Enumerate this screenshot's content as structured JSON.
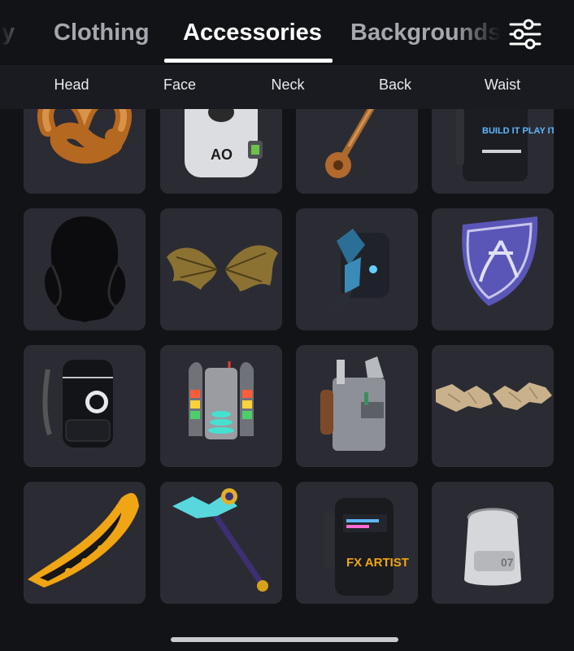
{
  "tabs": {
    "partial": "ly",
    "clothing": "Clothing",
    "accessories": "Accessories",
    "backgrounds": "Backgrounds",
    "active": "Accessories"
  },
  "subcategories": [
    "Head",
    "Face",
    "Neck",
    "Back",
    "Waist"
  ],
  "icons": {
    "filter": "sliders-icon"
  },
  "items": [
    {
      "name": "pretzel-accessory",
      "text": ""
    },
    {
      "name": "koala-backpack",
      "text": "AO"
    },
    {
      "name": "copper-mace",
      "text": ""
    },
    {
      "name": "build-it-backpack",
      "text": "BUILD IT PLAY IT"
    },
    {
      "name": "shadow-cloak",
      "text": ""
    },
    {
      "name": "golden-bat-wings",
      "text": ""
    },
    {
      "name": "blue-crystal-jetpack",
      "text": ""
    },
    {
      "name": "phoenix-shield",
      "text": ""
    },
    {
      "name": "jurassic-world-backpack",
      "text": ""
    },
    {
      "name": "rainbow-jetpack",
      "text": ""
    },
    {
      "name": "builder-backpack",
      "text": ""
    },
    {
      "name": "paper-scroll-wings",
      "text": ""
    },
    {
      "name": "gold-black-blade",
      "text": ""
    },
    {
      "name": "crystal-staff",
      "text": ""
    },
    {
      "name": "fx-artist-backpack",
      "text": "FX ARTIST"
    },
    {
      "name": "silver-backpack",
      "text": "07"
    }
  ],
  "colors": {
    "background": "#121317",
    "tile": "#2b2c33",
    "subbar": "#191b20",
    "accent": "#ffffff"
  }
}
